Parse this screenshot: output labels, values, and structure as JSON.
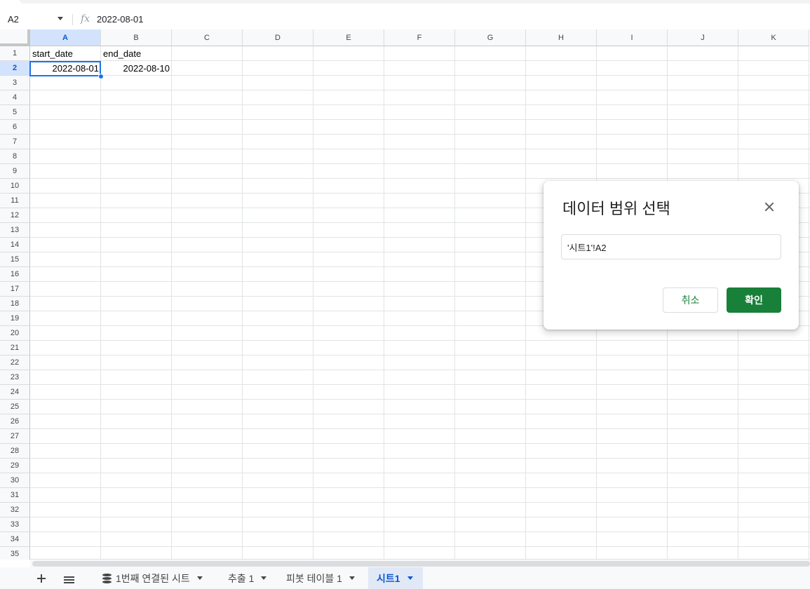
{
  "formula_bar": {
    "cell_ref": "A2",
    "fx_label": "fx",
    "value": "2022-08-01"
  },
  "columns": [
    "A",
    "B",
    "C",
    "D",
    "E",
    "F",
    "G",
    "H",
    "I",
    "J",
    "K"
  ],
  "selected_column": "A",
  "rows": [
    "1",
    "2",
    "3",
    "4",
    "5",
    "6",
    "7",
    "8",
    "9",
    "10",
    "11",
    "12",
    "13",
    "14",
    "15",
    "16",
    "17",
    "18",
    "19",
    "20",
    "21",
    "22",
    "23",
    "24",
    "25",
    "26",
    "27",
    "28",
    "29",
    "30",
    "31",
    "32",
    "33",
    "34",
    "35"
  ],
  "selected_row": "2",
  "cells": {
    "A1": "start_date",
    "B1": "end_date",
    "A2": "2022-08-01",
    "B2": "2022-08-10"
  },
  "sheet_tabs": [
    {
      "label": "1번째 연결된 시트",
      "icon": "database-icon",
      "active": false
    },
    {
      "label": "추출 1",
      "active": false
    },
    {
      "label": "피봇 테이블 1",
      "active": false
    },
    {
      "label": "시트1",
      "active": true
    }
  ],
  "dialog": {
    "title": "데이터 범위 선택",
    "range_value": "'시트1'!A2",
    "cancel_label": "취소",
    "ok_label": "확인"
  },
  "colors": {
    "accent": "#1a73e8",
    "selected_header_bg": "#d3e3fd",
    "ok_button": "#188038"
  }
}
